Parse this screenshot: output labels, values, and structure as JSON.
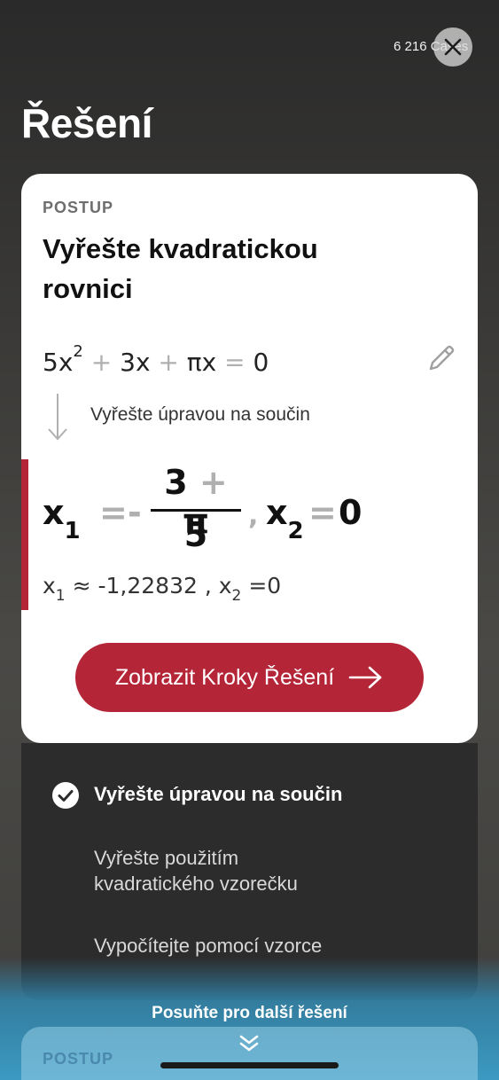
{
  "header": {
    "count_text": "6 216 Cases",
    "title": "Řešení"
  },
  "card": {
    "label": "POSTUP",
    "title": "Vyřešte kvadratickou rovnici",
    "equation": {
      "t1": "5x",
      "exp": "2",
      "plus1": "+",
      "t2": "3x",
      "plus2": "+",
      "t3": "πx",
      "eq": "=",
      "rhs": "0"
    },
    "method_text": "Vyřešte úpravou na součin",
    "result": {
      "x1": "x",
      "x1_sub": "1",
      "eq1": "=",
      "minus": "-",
      "num_a": "3",
      "num_op": "+",
      "num_b": "π",
      "den": "5",
      "comma": ",",
      "x2": "x",
      "x2_sub": "2",
      "eq2": "=",
      "zero": "0"
    },
    "approx": {
      "x1": "x",
      "x1_sub": "1",
      "approx_sign": "≈",
      "x1_val": "-1,22832",
      "sep": ",",
      "x2": "x",
      "x2_sub": "2",
      "eq": "=",
      "x2_val": "0"
    },
    "button_label": "Zobrazit Kroky Řešení"
  },
  "methods": [
    {
      "label": "Vyřešte úpravou na součin",
      "active": true
    },
    {
      "label": "Vyřešte použitím kvadratického vzorečku",
      "active": false
    },
    {
      "label": "Vypočítejte pomocí vzorce",
      "active": false
    }
  ],
  "footer": {
    "swipe_hint": "Posuňte pro další řešení",
    "next_card_label": "POSTUP"
  },
  "colors": {
    "accent": "#b52538",
    "bottom_gradient": "#3c9ac2"
  },
  "icons": [
    "close-icon",
    "edit-pencil-icon",
    "arrow-down-icon",
    "arrow-right-icon",
    "check-circle-icon",
    "double-chevron-down-icon"
  ]
}
